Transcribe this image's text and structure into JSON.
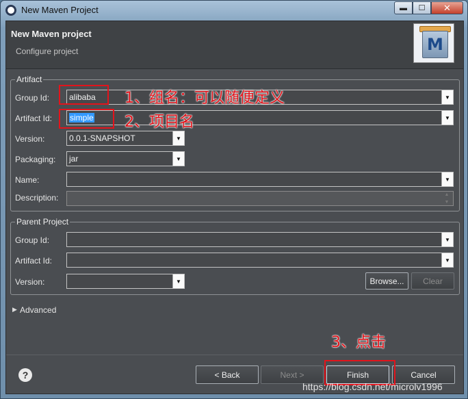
{
  "window": {
    "title": "New Maven Project",
    "controls": {
      "minimize": "▬",
      "maximize": "☐",
      "close": "✕"
    }
  },
  "header": {
    "title": "New Maven project",
    "subtitle": "Configure project",
    "logo_letter": "M"
  },
  "artifact": {
    "legend": "Artifact",
    "group_id": {
      "label": "Group Id:",
      "value": "alibaba"
    },
    "artifact_id": {
      "label": "Artifact Id:",
      "value": "simple"
    },
    "version": {
      "label": "Version:",
      "value": "0.0.1-SNAPSHOT"
    },
    "packaging": {
      "label": "Packaging:",
      "value": "jar"
    },
    "name": {
      "label": "Name:",
      "value": ""
    },
    "description": {
      "label": "Description:",
      "value": ""
    }
  },
  "parent": {
    "legend": "Parent Project",
    "group_id": {
      "label": "Group Id:",
      "value": ""
    },
    "artifact_id": {
      "label": "Artifact Id:",
      "value": ""
    },
    "version": {
      "label": "Version:",
      "value": ""
    },
    "browse_label": "Browse...",
    "clear_label": "Clear"
  },
  "advanced": {
    "label": "Advanced"
  },
  "annotations": {
    "step1": "1、组名：可以随便定义",
    "step2": "2、项目名",
    "step3": "3、点击"
  },
  "footer": {
    "help": "?",
    "back_label": "< Back",
    "next_label": "Next >",
    "finish_label": "Finish",
    "cancel_label": "Cancel"
  },
  "watermark": "https://blog.csdn.net/microlv1996",
  "colors": {
    "annotation_red": "#e0141b",
    "selection_blue": "#3399ff"
  }
}
